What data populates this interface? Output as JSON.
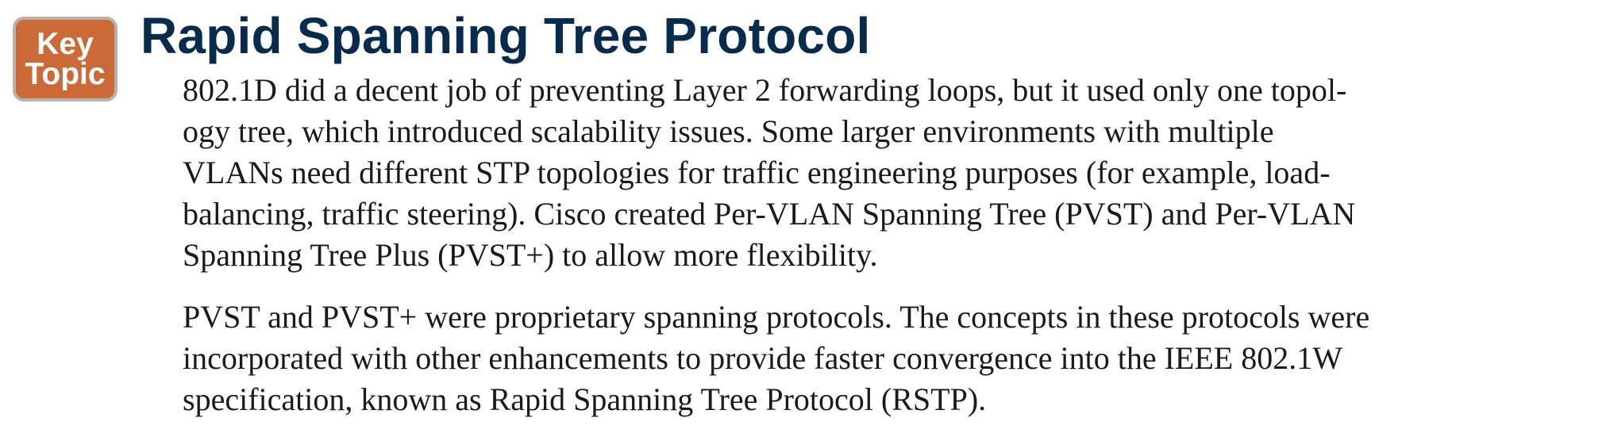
{
  "badge": {
    "line1": "Key",
    "line2": "Topic"
  },
  "section": {
    "title": "Rapid Spanning Tree Protocol"
  },
  "paragraphs": [
    {
      "lines": [
        "802.1D did a decent job of preventing Layer 2 forwarding loops, but it used only one topol-",
        "ogy tree, which introduced scalability issues. Some larger environments with multiple",
        "VLANs need different STP topologies for traffic engineering purposes (for example, load-",
        "balancing, traffic steering). Cisco created Per-VLAN Spanning Tree (PVST) and Per-VLAN",
        "Spanning Tree Plus (PVST+) to allow more flexibility."
      ]
    },
    {
      "lines": [
        "PVST and PVST+ were proprietary spanning protocols. The concepts in these protocols were",
        "incorporated with other enhancements to provide faster convergence into the IEEE 802.1W",
        "specification, known as Rapid Spanning Tree Protocol (RSTP)."
      ]
    }
  ],
  "colors": {
    "title": "#062b4d",
    "badge_fill": "#cc6a37",
    "badge_border": "#b8b2ac",
    "body_text": "#1a1a1a"
  }
}
